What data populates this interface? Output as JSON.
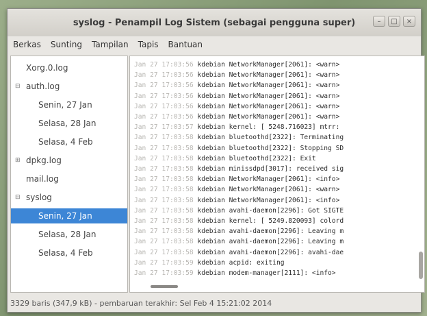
{
  "window": {
    "title": "syslog - Penampil Log Sistem (sebagai pengguna super)",
    "controls": {
      "minimize": "–",
      "maximize": "□",
      "close": "×"
    }
  },
  "menu": [
    "Berkas",
    "Sunting",
    "Tampilan",
    "Tapis",
    "Bantuan"
  ],
  "sidebar": {
    "items": [
      {
        "label": "Xorg.0.log",
        "level": 0,
        "expander": "",
        "selected": false
      },
      {
        "label": "auth.log",
        "level": 0,
        "expander": "⊟",
        "selected": false
      },
      {
        "label": "Senin, 27 Jan",
        "level": 1,
        "expander": "",
        "selected": false
      },
      {
        "label": "Selasa, 28 Jan",
        "level": 1,
        "expander": "",
        "selected": false
      },
      {
        "label": "Selasa, 4 Feb",
        "level": 1,
        "expander": "",
        "selected": false
      },
      {
        "label": "dpkg.log",
        "level": 0,
        "expander": "⊞",
        "selected": false
      },
      {
        "label": "mail.log",
        "level": 0,
        "expander": "",
        "selected": false
      },
      {
        "label": "syslog",
        "level": 0,
        "expander": "⊟",
        "selected": false
      },
      {
        "label": "Senin, 27 Jan",
        "level": 1,
        "expander": "",
        "selected": true
      },
      {
        "label": "Selasa, 28 Jan",
        "level": 1,
        "expander": "",
        "selected": false
      },
      {
        "label": "Selasa, 4 Feb",
        "level": 1,
        "expander": "",
        "selected": false
      }
    ]
  },
  "log": {
    "lines": [
      {
        "ts": "Jan 27 17:03:56",
        "msg": "kdebian NetworkManager[2061]: <warn>"
      },
      {
        "ts": "Jan 27 17:03:56",
        "msg": "kdebian NetworkManager[2061]: <warn>"
      },
      {
        "ts": "Jan 27 17:03:56",
        "msg": "kdebian NetworkManager[2061]: <warn>"
      },
      {
        "ts": "Jan 27 17:03:56",
        "msg": "kdebian NetworkManager[2061]: <warn>"
      },
      {
        "ts": "Jan 27 17:03:56",
        "msg": "kdebian NetworkManager[2061]: <warn>"
      },
      {
        "ts": "Jan 27 17:03:56",
        "msg": "kdebian NetworkManager[2061]: <warn>"
      },
      {
        "ts": "Jan 27 17:03:57",
        "msg": "kdebian kernel: [ 5248.716023] mtrr:"
      },
      {
        "ts": "Jan 27 17:03:58",
        "msg": "kdebian bluetoothd[2322]: Terminating"
      },
      {
        "ts": "Jan 27 17:03:58",
        "msg": "kdebian bluetoothd[2322]: Stopping SD"
      },
      {
        "ts": "Jan 27 17:03:58",
        "msg": "kdebian bluetoothd[2322]: Exit"
      },
      {
        "ts": "Jan 27 17:03:58",
        "msg": "kdebian minissdpd[3017]: received sig"
      },
      {
        "ts": "Jan 27 17:03:58",
        "msg": "kdebian NetworkManager[2061]: <info>"
      },
      {
        "ts": "Jan 27 17:03:58",
        "msg": "kdebian NetworkManager[2061]: <warn>"
      },
      {
        "ts": "Jan 27 17:03:58",
        "msg": "kdebian NetworkManager[2061]: <info>"
      },
      {
        "ts": "Jan 27 17:03:58",
        "msg": "kdebian avahi-daemon[2296]: Got SIGTE"
      },
      {
        "ts": "Jan 27 17:03:58",
        "msg": "kdebian kernel: [ 5249.820093] colord"
      },
      {
        "ts": "Jan 27 17:03:58",
        "msg": "kdebian avahi-daemon[2296]: Leaving m"
      },
      {
        "ts": "Jan 27 17:03:58",
        "msg": "kdebian avahi-daemon[2296]: Leaving m"
      },
      {
        "ts": "Jan 27 17:03:58",
        "msg": "kdebian avahi-daemon[2296]: avahi-dae"
      },
      {
        "ts": "Jan 27 17:03:59",
        "msg": "kdebian acpid: exiting"
      },
      {
        "ts": "Jan 27 17:03:59",
        "msg": "kdebian modem-manager[2111]: <info>"
      }
    ],
    "vscroll_position": 0.95
  },
  "status": {
    "text": "3329 baris (347,9 kB) - pembaruan terakhir: Sel Feb  4 15:21:02 2014"
  }
}
